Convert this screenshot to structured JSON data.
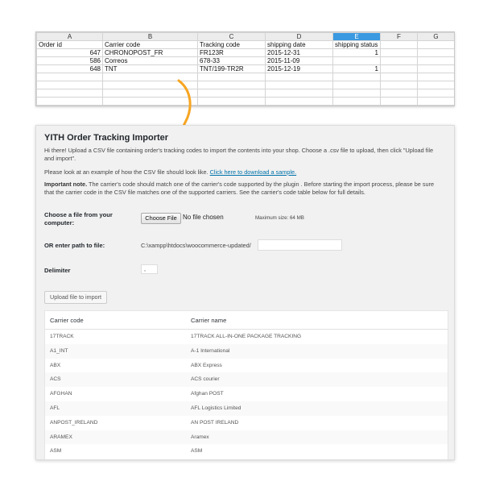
{
  "sheet": {
    "col_letters": [
      "A",
      "B",
      "C",
      "D",
      "E",
      "F",
      "G"
    ],
    "rows": [
      [
        "Order id",
        "Carrier code",
        "Tracking code",
        "shipping date",
        "shipping status",
        "",
        ""
      ],
      [
        "647",
        "CHRONOPOST_FR",
        "FR123R",
        "2015-12-31",
        "1",
        "",
        ""
      ],
      [
        "586",
        "Correos",
        "678-33",
        "2015-11-09",
        "",
        "",
        ""
      ],
      [
        "648",
        "TNT",
        "TNT/199-TR2R",
        "2015-12-19",
        "1",
        "",
        ""
      ],
      [
        "",
        "",
        "",
        "",
        "",
        "",
        ""
      ],
      [
        "",
        "",
        "",
        "",
        "",
        "",
        ""
      ],
      [
        "",
        "",
        "",
        "",
        "",
        "",
        ""
      ],
      [
        "",
        "",
        "",
        "",
        "",
        "",
        ""
      ]
    ]
  },
  "colors": {
    "accent": "#f7a521",
    "link": "#0073aa",
    "selected_col": "#3a99e0"
  },
  "panel": {
    "title": "YITH Order Tracking Importer",
    "intro": "Hi there! Upload a CSV file containing order's tracking codes to import the contents into your shop. Choose a .csv file to upload, then click \"Upload file and import\".",
    "example_prefix": "Please look at an example of how the CSV file should look like.",
    "example_link": "Click here to download a sample.",
    "note_label": "Important note.",
    "note_text": "The carrier's code should match one of the carrier's code supported by the plugin . Before starting the import process, please be sure that the carrier code in the CSV file matches one of the supported carriers. See the carrier's code table below for full details.",
    "choose_label": "Choose a file from your computer:",
    "choose_button": "Choose File",
    "no_file": "No file chosen",
    "max_size": "Maximum size: 64 MB",
    "path_label": "OR enter path to file:",
    "path_prefix": "C:\\xampp\\htdocs\\woocommerce-updated/",
    "path_value": "",
    "delimiter_label": "Delimiter",
    "delimiter_value": ",",
    "upload_button": "Upload file to import"
  },
  "carriers": {
    "col_code": "Carrier code",
    "col_name": "Carrier name",
    "rows": [
      [
        "17TRACK",
        "17TRACK ALL-IN-ONE PACKAGE TRACKING"
      ],
      [
        "A1_INT",
        "A-1 International"
      ],
      [
        "ABX",
        "ABX Express"
      ],
      [
        "ACS",
        "ACS courier"
      ],
      [
        "AFGHAN",
        "Afghan POST"
      ],
      [
        "AFL",
        "AFL Logistics Limited"
      ],
      [
        "ANPOST_IRELAND",
        "AN POST IRELAND"
      ],
      [
        "ARAMEX",
        "Aramex"
      ],
      [
        "ASM",
        "ASM"
      ]
    ]
  }
}
